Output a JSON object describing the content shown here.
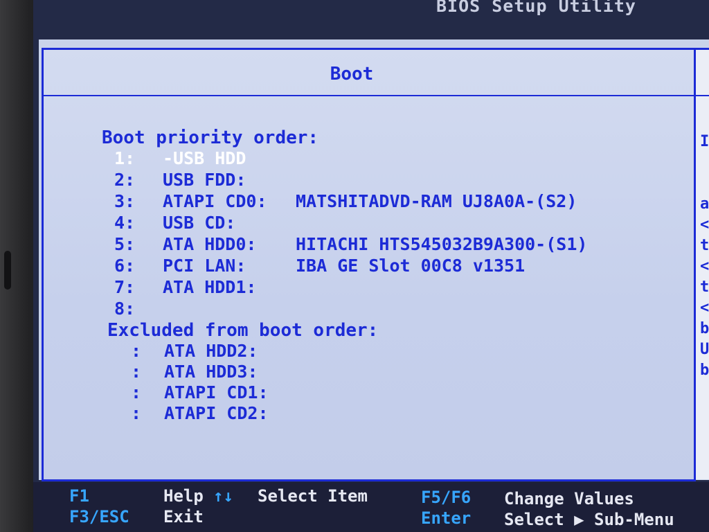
{
  "header": {
    "title": "BIOS Setup Utility"
  },
  "panel": {
    "title": "Boot"
  },
  "boot_priority": {
    "heading": "Boot priority order:",
    "items": [
      {
        "num": "1:",
        "device": "-USB HDD",
        "detail": "",
        "selected": true
      },
      {
        "num": "2:",
        "device": "USB FDD:",
        "detail": ""
      },
      {
        "num": "3:",
        "device": "ATAPI CD0:",
        "detail": "MATSHITADVD-RAM UJ8A0A-(S2)"
      },
      {
        "num": "4:",
        "device": "USB CD:",
        "detail": ""
      },
      {
        "num": "5:",
        "device": "ATA HDD0:",
        "detail": "HITACHI HTS545032B9A300-(S1)"
      },
      {
        "num": "6:",
        "device": "PCI LAN:",
        "detail": "IBA GE Slot 00C8 v1351"
      },
      {
        "num": "7:",
        "device": "ATA HDD1:",
        "detail": ""
      },
      {
        "num": "8:",
        "device": "",
        "detail": ""
      }
    ]
  },
  "excluded": {
    "heading": "Excluded from boot order:",
    "items": [
      {
        "num": ":",
        "device": "ATA HDD2:"
      },
      {
        "num": ":",
        "device": "ATA HDD3:"
      },
      {
        "num": ":",
        "device": "ATAPI CD1:"
      },
      {
        "num": ":",
        "device": "ATAPI CD2:"
      }
    ]
  },
  "help_pane": {
    "glyphs": [
      "I",
      "",
      "",
      "a",
      "<",
      "t",
      "<",
      "t",
      "<",
      "b",
      "U",
      "b"
    ]
  },
  "footer": {
    "f1_key": "F1",
    "f1_label": "Help",
    "arrows_key": "↑↓",
    "arrows_label": "Select Item",
    "f5f6_key": "F5/F6",
    "f5f6_label": "Change Values",
    "f3_key": "F3/ESC",
    "f3_label": "Exit",
    "enter_key": "Enter",
    "enter_label": "Select ▶ Sub-Menu"
  },
  "colors": {
    "accent": "#1c2bd6",
    "selected": "#ffffff",
    "footer_key": "#37a6ff",
    "footer_bg": "#1c1f38"
  }
}
